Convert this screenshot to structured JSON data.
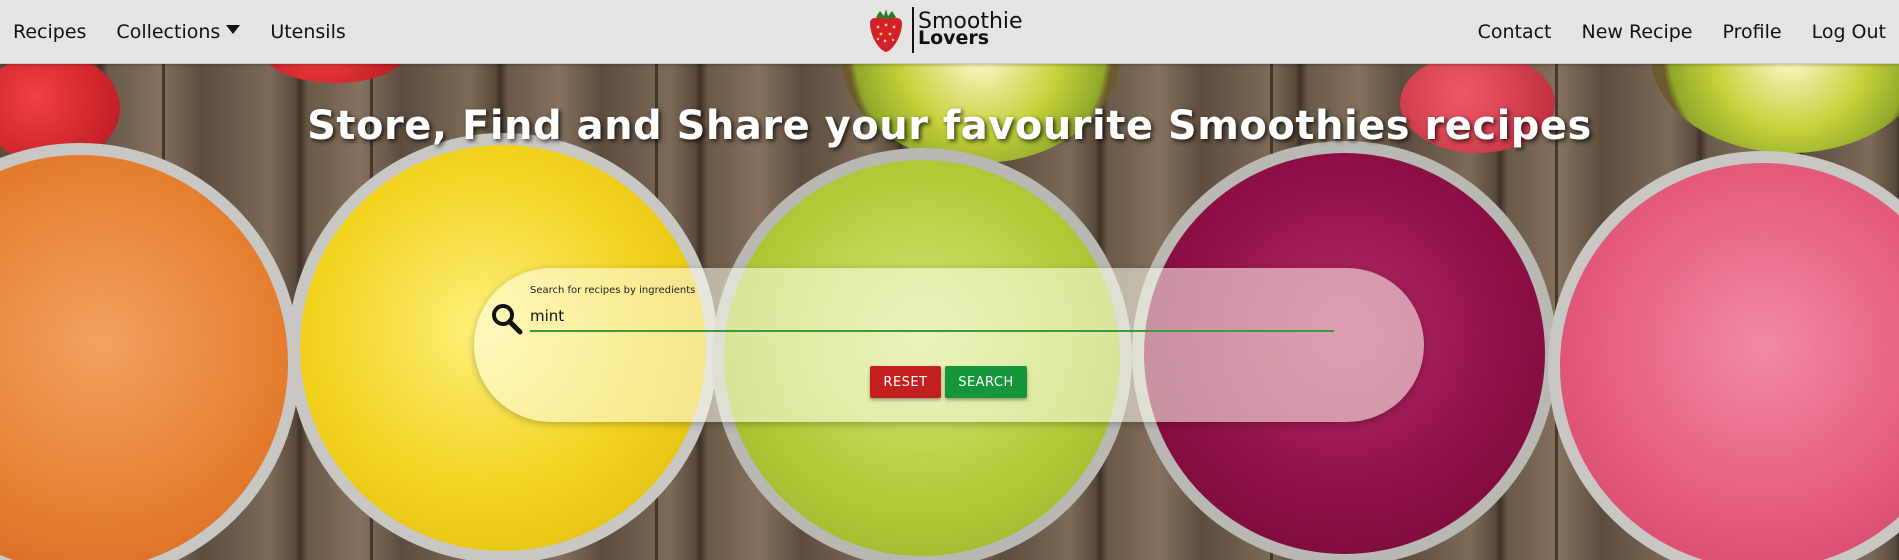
{
  "nav": {
    "left_items": [
      {
        "label": "Recipes"
      },
      {
        "label": "Collections"
      },
      {
        "label": "Utensils"
      }
    ],
    "right_items": [
      {
        "label": "Contact"
      },
      {
        "label": "New Recipe"
      },
      {
        "label": "Profile"
      },
      {
        "label": "Log Out"
      }
    ],
    "brand": {
      "line1": "Smoothie",
      "line2": "Lovers",
      "logo_icon": "strawberry-icon"
    }
  },
  "hero": {
    "title": "Store, Find and Share your favourite Smoothies recipes"
  },
  "search": {
    "label": "Search for recipes by ingredients",
    "value": "mint",
    "reset_label": "RESET",
    "search_label": "SEARCH",
    "icon": "search-icon"
  },
  "colors": {
    "nav_bg": "#e4e5e2",
    "reset": "#c41f1f",
    "search": "#16953a",
    "input_underline": "#3c9a3c"
  }
}
